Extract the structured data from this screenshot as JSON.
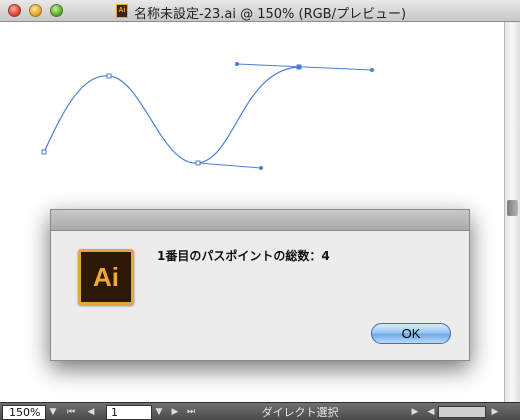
{
  "window": {
    "title": "名称未設定-23.ai @ 150% (RGB/プレビュー)",
    "doc_icon_label": "Ai"
  },
  "canvas": {
    "path_color": "#4a7fd4",
    "anchor_fill": "#ffffff",
    "handle_fill": "#4a7fd4"
  },
  "dialog": {
    "icon_label": "Ai",
    "message": "1番目のパスポイントの総数：4",
    "ok_label": "OK"
  },
  "statusbar": {
    "zoom_value": "150%",
    "page_value": "1",
    "tool_name": "ダイレクト選択"
  }
}
